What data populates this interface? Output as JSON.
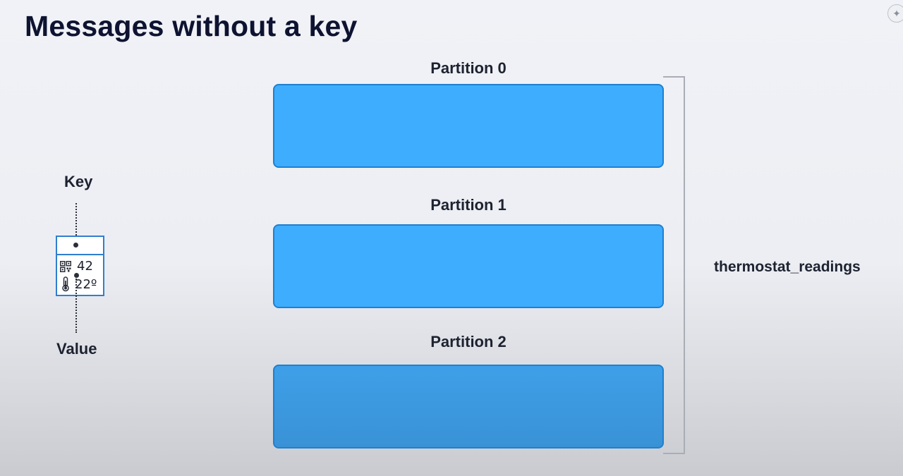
{
  "title": "Messages without a key",
  "partitions": [
    {
      "label": "Partition 0"
    },
    {
      "label": "Partition 1"
    },
    {
      "label": "Partition 2"
    }
  ],
  "topic": "thermostat_readings",
  "message": {
    "key_label": "Key",
    "value_label": "Value",
    "device_id": "42",
    "temperature": "22º",
    "device_icon": "qr-code-icon",
    "temperature_icon": "thermometer-icon"
  },
  "colors": {
    "title": "#0d1330",
    "partition_fill": "#3fadfd",
    "partition_border": "#1e80d0",
    "card_border": "#2f7fd0",
    "bracket": "#a9adb5"
  }
}
